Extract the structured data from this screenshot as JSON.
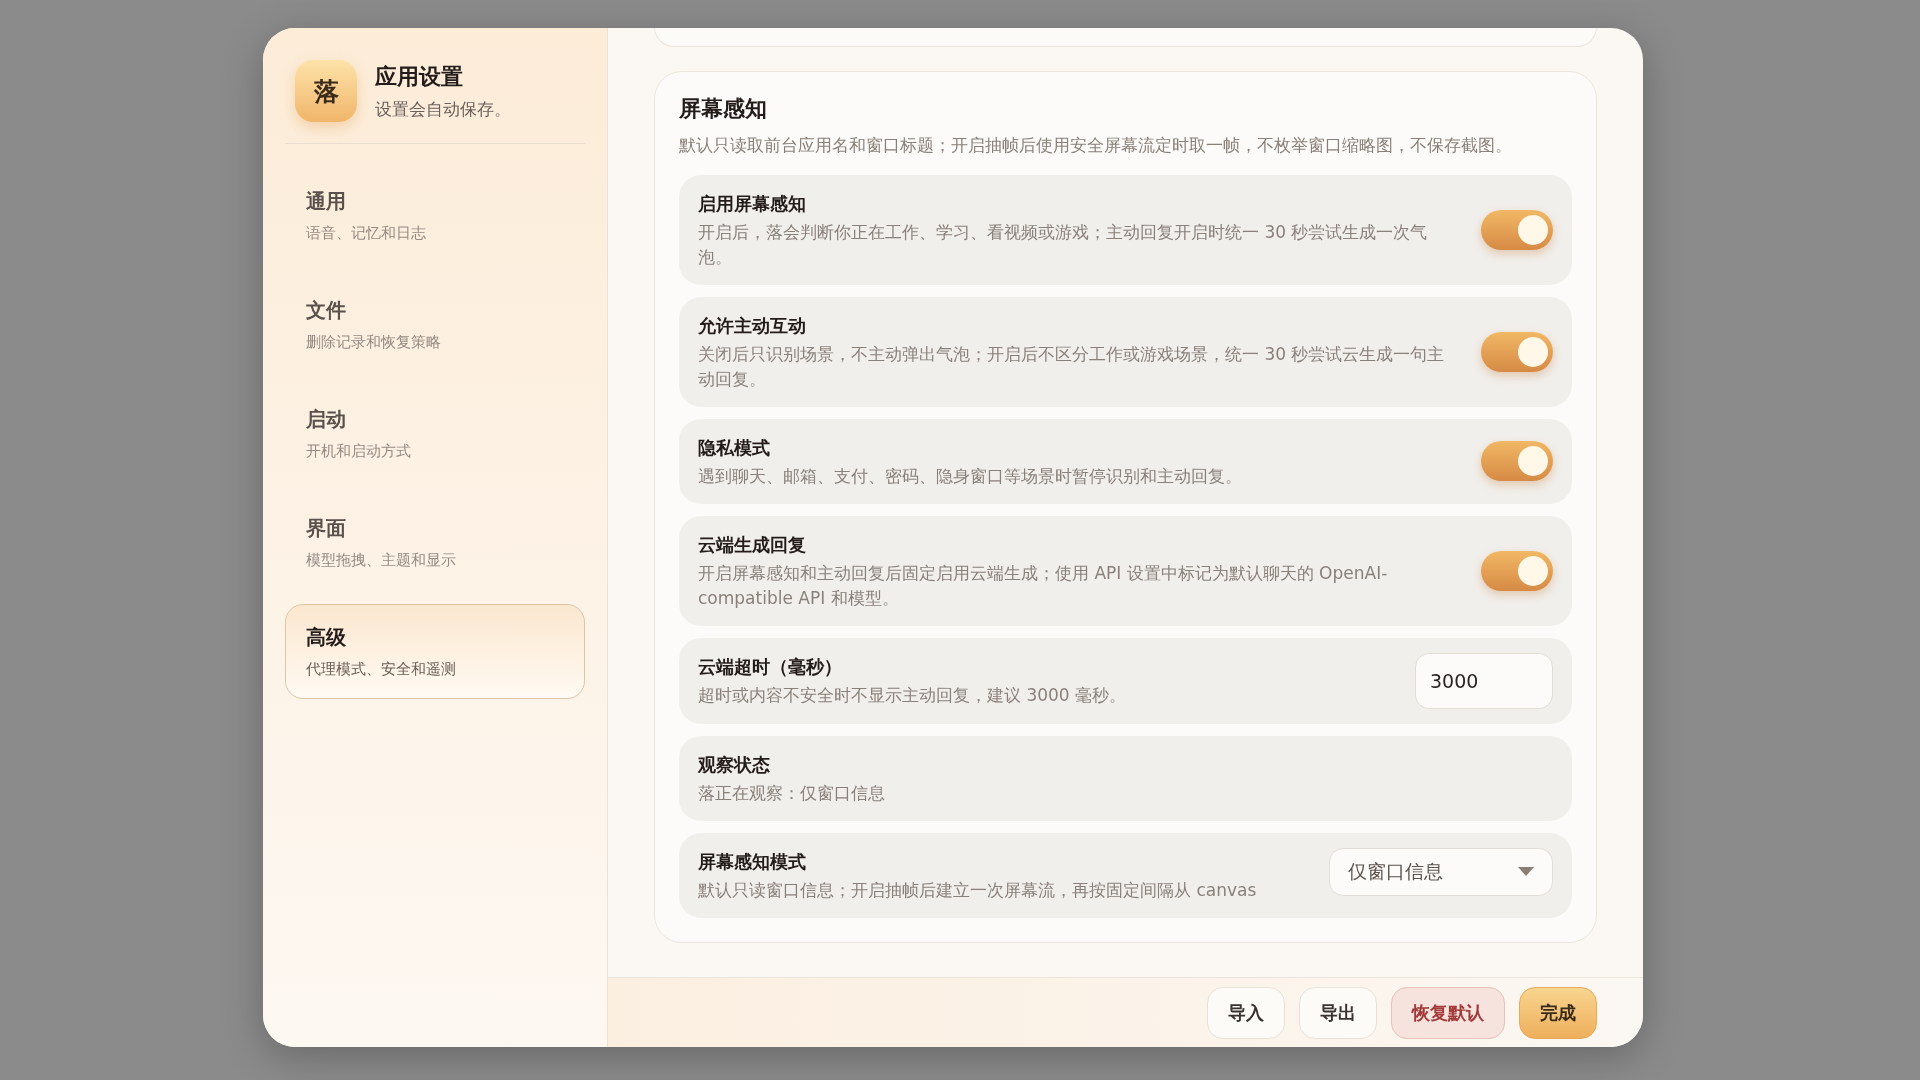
{
  "app": {
    "logo": "落",
    "title": "应用设置",
    "subtitle": "设置会自动保存。"
  },
  "sidebar": {
    "items": [
      {
        "label": "通用",
        "description": "语音、记忆和日志",
        "selected": false
      },
      {
        "label": "文件",
        "description": "删除记录和恢复策略",
        "selected": false
      },
      {
        "label": "启动",
        "description": "开机和启动方式",
        "selected": false
      },
      {
        "label": "界面",
        "description": "模型拖拽、主题和显示",
        "selected": false
      },
      {
        "label": "高级",
        "description": "代理模式、安全和遥测",
        "selected": true
      }
    ]
  },
  "section": {
    "title": "屏幕感知",
    "description": "默认只读取前台应用名和窗口标题；开启抽帧后使用安全屏幕流定时取一帧，不枚举窗口缩略图，不保存截图。",
    "settings": [
      {
        "kind": "toggle",
        "title": "启用屏幕感知",
        "description": "开启后，落会判断你正在工作、学习、看视频或游戏；主动回复开启时统一 30 秒尝试生成一次气泡。",
        "on": true
      },
      {
        "kind": "toggle",
        "title": "允许主动互动",
        "description": "关闭后只识别场景，不主动弹出气泡；开启后不区分工作或游戏场景，统一 30 秒尝试云生成一句主动回复。",
        "on": true
      },
      {
        "kind": "toggle",
        "title": "隐私模式",
        "description": "遇到聊天、邮箱、支付、密码、隐身窗口等场景时暂停识别和主动回复。",
        "on": true
      },
      {
        "kind": "toggle",
        "title": "云端生成回复",
        "description": "开启屏幕感知和主动回复后固定启用云端生成；使用 API 设置中标记为默认聊天的 OpenAI-compatible API 和模型。",
        "on": true
      },
      {
        "kind": "number",
        "title": "云端超时（毫秒）",
        "description": "超时或内容不安全时不显示主动回复，建议 3000 毫秒。",
        "value": "3000"
      },
      {
        "kind": "status",
        "title": "观察状态",
        "description": "落正在观察：仅窗口信息"
      },
      {
        "kind": "select",
        "title": "屏幕感知模式",
        "description": "默认只读窗口信息；开启抽帧后建立一次屏幕流，再按固定间隔从 canvas",
        "value": "仅窗口信息"
      }
    ]
  },
  "footer": {
    "buttons": [
      {
        "kind": "plain",
        "label": "导入"
      },
      {
        "kind": "plain",
        "label": "导出"
      },
      {
        "kind": "danger",
        "label": "恢复默认"
      },
      {
        "kind": "primary",
        "label": "完成"
      }
    ]
  }
}
